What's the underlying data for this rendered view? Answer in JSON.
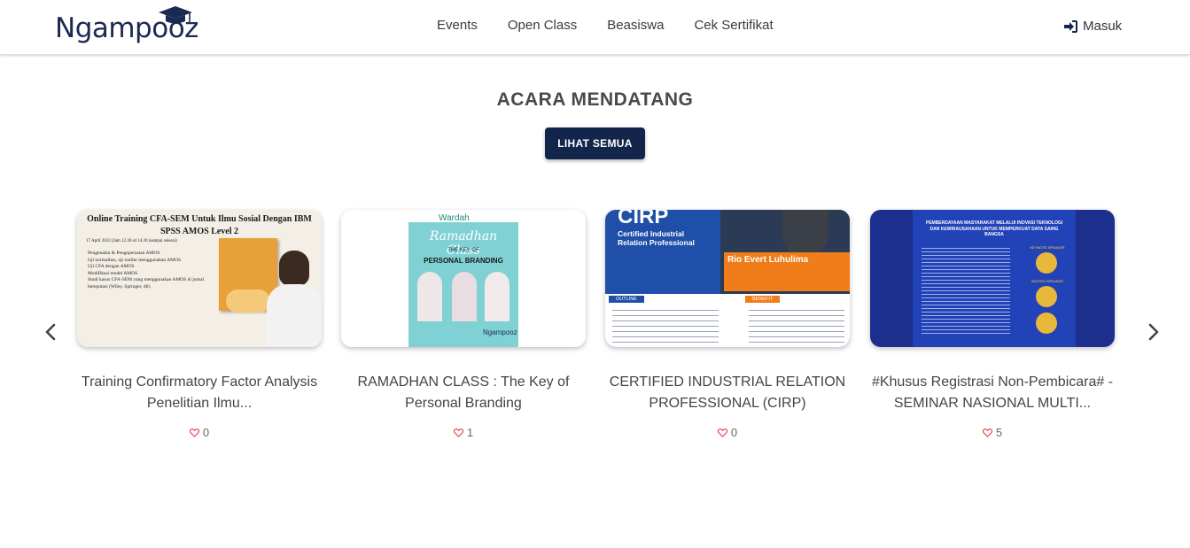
{
  "brand": {
    "name": "Ngampooz"
  },
  "nav": {
    "items": [
      {
        "label": "Events"
      },
      {
        "label": "Open Class"
      },
      {
        "label": "Beasiswa"
      },
      {
        "label": "Cek Sertifikat"
      }
    ],
    "login_label": "Masuk",
    "login_icon": "sign-in-icon"
  },
  "section": {
    "title": "ACARA MENDATANG",
    "see_all_label": "LIHAT SEMUA"
  },
  "carousel": {
    "prev_icon": "chevron-left-icon",
    "next_icon": "chevron-right-icon",
    "cards": [
      {
        "title": "Training Confirmatory Factor Analysis Penelitian Ilmu...",
        "likes": "0",
        "poster": {
          "heading": "Online Training CFA-SEM Untuk Ilmu Sosial Dengan IBM SPSS AMOS Level 2",
          "date": "17 April 2022 (Jam 12.30 sd 14.30 (sampai selesai)",
          "points": [
            "Pengenalan & Pengoperasian AMOS",
            "Uji normalitas, uji outlier menggunakan AMOS",
            "Uji CFA dengan AMOS",
            "Modifikasi model AMOS",
            "Studi kasus CFA-SEM yang menggunakan AMOS di jurnal bereputasi (Wiley, Springer, dll)"
          ]
        }
      },
      {
        "title": "RAMADHAN CLASS : The Key of Personal Branding",
        "likes": "1",
        "poster": {
          "sponsor": "Wardah",
          "script": "Ramadhan Class",
          "subtitle": "THE KEY OF",
          "heading": "PERSONAL BRANDING",
          "brand": "Ngampooz"
        }
      },
      {
        "title": "CERTIFIED INDUSTRIAL RELATION PROFESSIONAL (CIRP)",
        "likes": "0",
        "poster": {
          "acronym": "CIRP",
          "subheading": "Certified Industrial Relation Professional",
          "speaker": "Rio Evert Luhulima",
          "outline_label": "OUTLINE",
          "benefit_label": "BENEFIT"
        }
      },
      {
        "title": "#Khusus Registrasi Non-Pembicara# - SEMINAR NASIONAL MULTI...",
        "likes": "5",
        "poster": {
          "heading": "PEMBERDAYAAN MASYARAKAT MELALUI INOVASI TEKNOLOGI DAN KEWIRAUSAHAAN UNTUK MEMPERKUAT DAYA SAING BANGSA",
          "keynote_label": "KEYNOTE SPEAKER",
          "invited_label": "INVITED SPEAKER"
        }
      }
    ]
  },
  "colors": {
    "primary": "#13254b",
    "heart": "#e53945",
    "cirp_orange": "#f07d1a",
    "cirp_blue": "#1f4fa8"
  }
}
